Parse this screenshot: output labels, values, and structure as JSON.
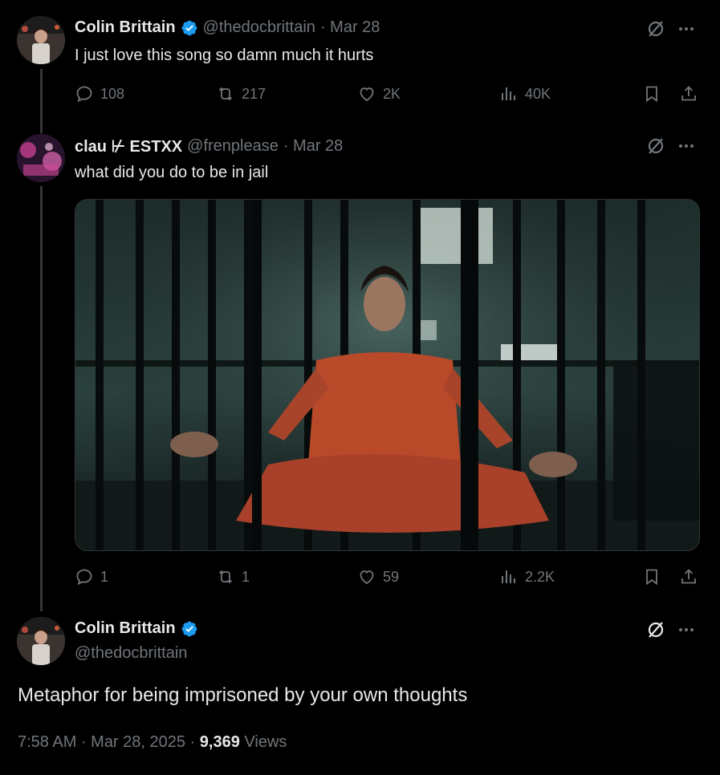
{
  "tweets": [
    {
      "name": "Colin Brittain",
      "handle": "@thedocbrittain",
      "date": "· Mar 28",
      "text": "I just love this song so damn much it hurts",
      "replies": "108",
      "retweets": "217",
      "likes": "2K",
      "views": "40K"
    },
    {
      "name": "clau ⊬ ESTXX",
      "handle": "@frenplease",
      "date": "· Mar 28",
      "text": "what did you do to be in jail",
      "replies": "1",
      "retweets": "1",
      "likes": "59",
      "views": "2.2K"
    }
  ],
  "main": {
    "name": "Colin Brittain",
    "handle": "@thedocbrittain",
    "text": "Metaphor for being imprisoned by your own thoughts",
    "time": "7:58 AM · Mar 28, 2025 · ",
    "views_count": "9,369",
    "views_label": " Views"
  },
  "colors": {
    "verified": "#1d9bf0",
    "muted": "#71767b",
    "text": "#e7e9ea"
  },
  "icons": [
    "verified-badge-icon",
    "grok-icon",
    "more-icon",
    "reply-icon",
    "retweet-icon",
    "like-icon",
    "views-icon",
    "bookmark-icon",
    "share-icon"
  ]
}
